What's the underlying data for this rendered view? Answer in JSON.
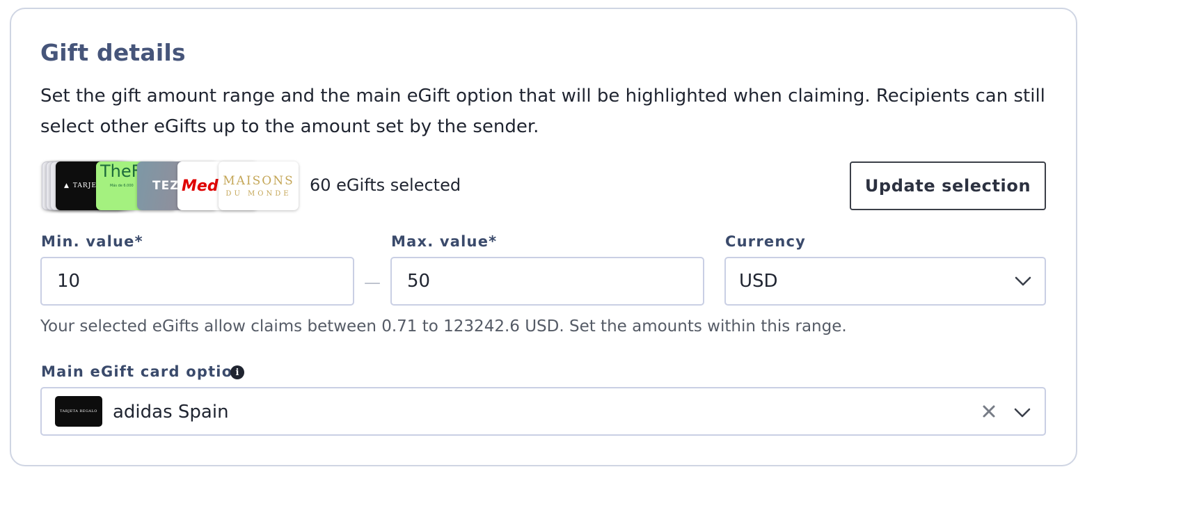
{
  "section": {
    "title": "Gift details",
    "description": "Set the gift amount range and the main eGift option that will be highlighted when claiming. Recipients can still select other eGifts up to the amount set by the sender."
  },
  "selection": {
    "cards": [
      {
        "name": "adidas",
        "text": "TARJET"
      },
      {
        "name": "TheFork",
        "text": "TheFo",
        "subtext": "Más de 6.000"
      },
      {
        "name": "Tezenis",
        "text": "TEZ"
      },
      {
        "name": "MediaMarkt",
        "text": "Media"
      },
      {
        "name": "Maisons du Monde",
        "text": "MAISONS",
        "subtext": "DU MONDE"
      }
    ],
    "count_text": "60 eGifts selected",
    "update_button": "Update selection"
  },
  "amounts": {
    "min_label": "Min. value*",
    "min_value": "10",
    "separator": "—",
    "max_label": "Max. value*",
    "max_value": "50",
    "currency_label": "Currency",
    "currency_value": "USD",
    "hint": "Your selected eGifts allow claims between 0.71 to 123242.6 USD. Set the amounts within this range."
  },
  "main_option": {
    "label": "Main eGift card option",
    "info_icon": "info-icon",
    "value": "adidas Spain",
    "thumb_text": "TARJETA REGALO"
  },
  "colors": {
    "title": "#46557a",
    "label": "#3a4a6b",
    "border": "#c9cfe4"
  }
}
